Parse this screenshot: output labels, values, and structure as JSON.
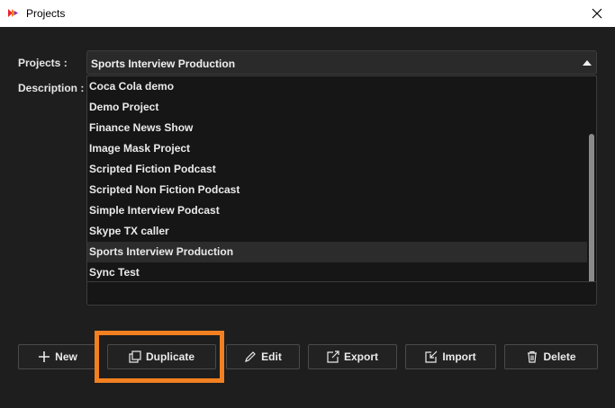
{
  "window": {
    "title": "Projects"
  },
  "form": {
    "projects_label": "Projects :",
    "description_label": "Description :",
    "selected_project": "Sports Interview Production"
  },
  "dropdown": {
    "items": [
      "Coca Cola demo",
      "Demo Project",
      "Finance News Show",
      "Image Mask Project",
      "Scripted Fiction Podcast",
      "Scripted Non Fiction Podcast",
      "Simple Interview Podcast",
      "Skype TX caller",
      "Sports Interview Production",
      "Sync Test"
    ],
    "selected_index": 8
  },
  "buttons": {
    "new": "New",
    "duplicate": "Duplicate",
    "edit": "Edit",
    "export": "Export",
    "import": "Import",
    "delete": "Delete"
  },
  "colors": {
    "background": "#1e1e1e",
    "highlight": "#f28021"
  }
}
